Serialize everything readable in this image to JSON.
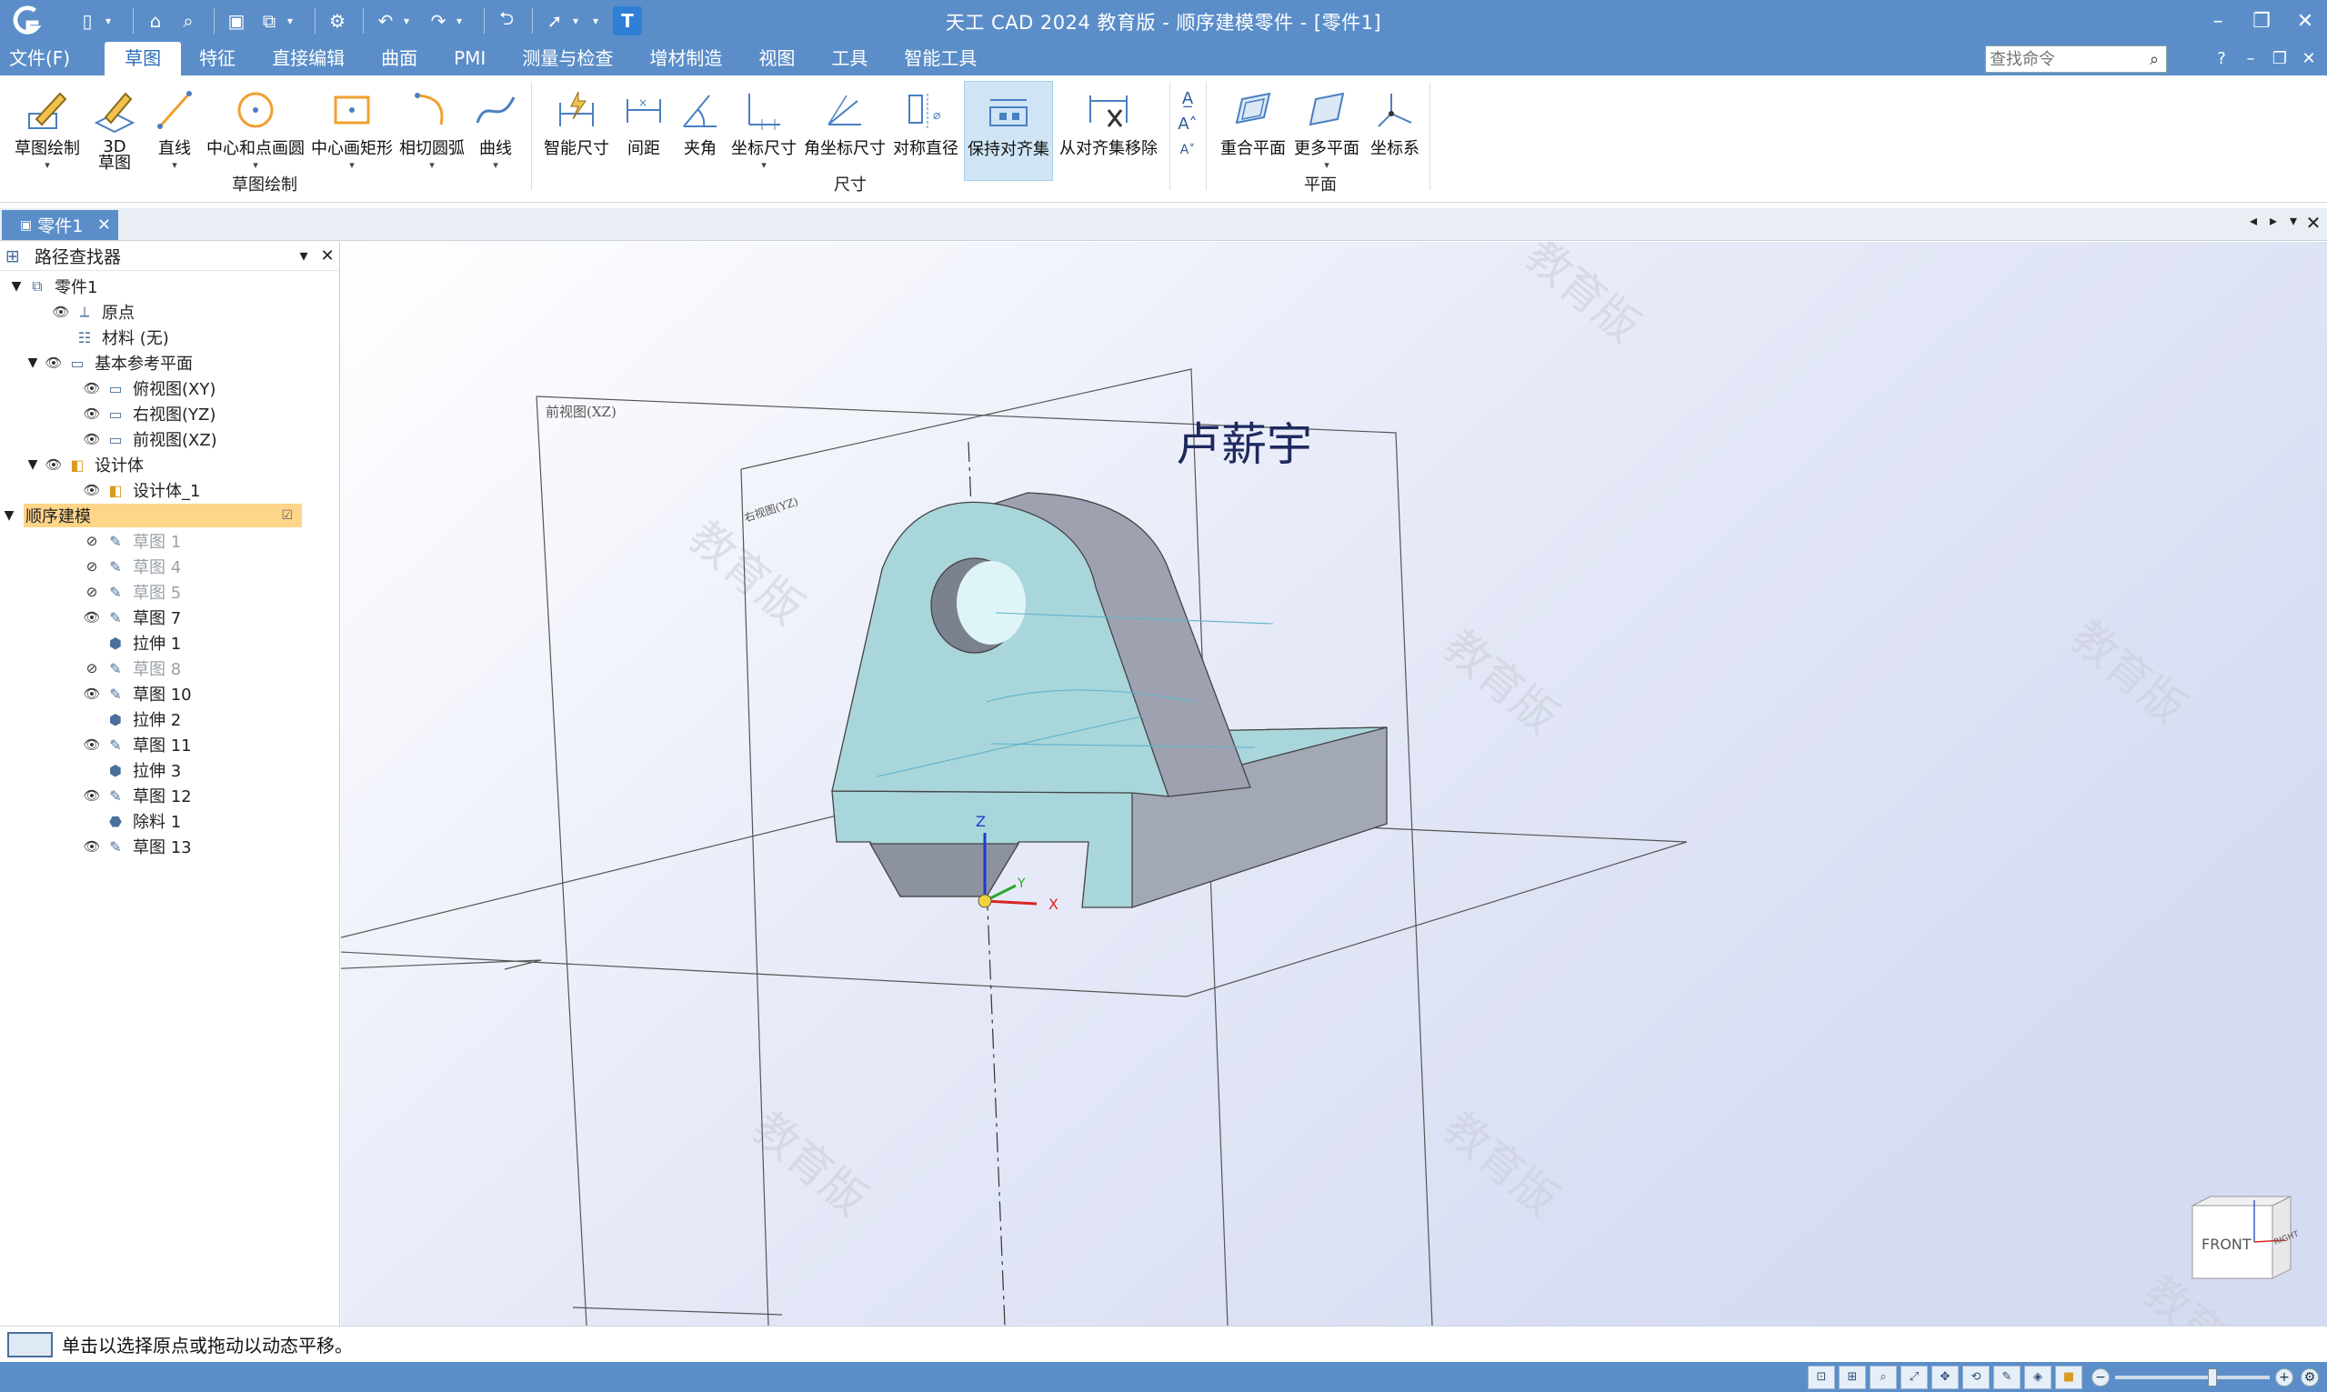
{
  "titlebar": {
    "title": "天工 CAD 2024 教育版 - 顺序建模零件 - [零件1]",
    "window_controls": [
      "minimize",
      "restore",
      "close"
    ]
  },
  "menubar": {
    "items": [
      {
        "label": "文件(F)"
      },
      {
        "label": "草图",
        "active": true
      },
      {
        "label": "特征"
      },
      {
        "label": "直接编辑"
      },
      {
        "label": "曲面"
      },
      {
        "label": "PMI"
      },
      {
        "label": "测量与检查"
      },
      {
        "label": "增材制造"
      },
      {
        "label": "视图"
      },
      {
        "label": "工具"
      },
      {
        "label": "智能工具"
      }
    ],
    "search_placeholder": "查找命令"
  },
  "ribbon": {
    "groups": [
      {
        "label": "草图绘制",
        "buttons": [
          {
            "label": "草图绘制",
            "icon": "sketch-pencil-icon"
          },
          {
            "label": "3D",
            "label2": "草图",
            "icon": "3d-sketch-icon"
          },
          {
            "label": "直线",
            "icon": "line-icon"
          },
          {
            "label": "中心和点画圆",
            "icon": "circle-center-icon"
          },
          {
            "label": "中心画矩形",
            "icon": "rectangle-center-icon"
          },
          {
            "label": "相切圆弧",
            "icon": "tangent-arc-icon"
          },
          {
            "label": "曲线",
            "icon": "curve-icon"
          }
        ]
      },
      {
        "label": "尺寸",
        "buttons": [
          {
            "label": "智能尺寸",
            "icon": "smart-dimension-icon"
          },
          {
            "label": "间距",
            "icon": "distance-icon"
          },
          {
            "label": "夹角",
            "icon": "angle-icon"
          },
          {
            "label": "坐标尺寸",
            "icon": "coordinate-dimension-icon"
          },
          {
            "label": "角坐标尺寸",
            "icon": "angular-coordinate-icon"
          },
          {
            "label": "对称直径",
            "icon": "symmetric-diameter-icon"
          },
          {
            "label": "保持对齐集",
            "icon": "keep-aligned-icon",
            "highlighted": true
          },
          {
            "label": "从对齐集移除",
            "icon": "remove-aligned-icon"
          }
        ]
      },
      {
        "label": "平面",
        "buttons": [
          {
            "label": "重合平面",
            "icon": "coincident-plane-icon"
          },
          {
            "label": "更多平面",
            "icon": "more-planes-icon"
          },
          {
            "label": "坐标系",
            "icon": "coordinate-system-icon"
          }
        ]
      }
    ]
  },
  "doc_tab": {
    "label": "零件1"
  },
  "pathfinder": {
    "title": "路径查找器",
    "items": [
      {
        "label": "零件1"
      },
      {
        "label": "原点"
      },
      {
        "label": "材料 (无)"
      },
      {
        "label": "基本参考平面"
      },
      {
        "label": "俯视图(XY)"
      },
      {
        "label": "右视图(YZ)"
      },
      {
        "label": "前视图(XZ)"
      },
      {
        "label": "设计体"
      },
      {
        "label": "设计体_1"
      },
      {
        "label": "顺序建模"
      },
      {
        "label": "草图 1"
      },
      {
        "label": "草图 4"
      },
      {
        "label": "草图 5"
      },
      {
        "label": "草图 7"
      },
      {
        "label": "拉伸 1"
      },
      {
        "label": "草图 8"
      },
      {
        "label": "草图 10"
      },
      {
        "label": "拉伸 2"
      },
      {
        "label": "草图 11"
      },
      {
        "label": "拉伸 3"
      },
      {
        "label": "草图 12"
      },
      {
        "label": "除料 1"
      },
      {
        "label": "草图 13"
      }
    ]
  },
  "viewport": {
    "front_plane_label": "前视图(XZ)",
    "right_plane_label": "右视图(YZ)",
    "annotation_text": "卢薪宇",
    "watermark": "教育版",
    "axis_labels": {
      "x": "X",
      "y": "Y",
      "z": "Z"
    },
    "view_cube": {
      "front": "FRONT",
      "right": "RIGHT"
    }
  },
  "status": {
    "message": "单击以选择原点或拖动以动态平移。"
  }
}
